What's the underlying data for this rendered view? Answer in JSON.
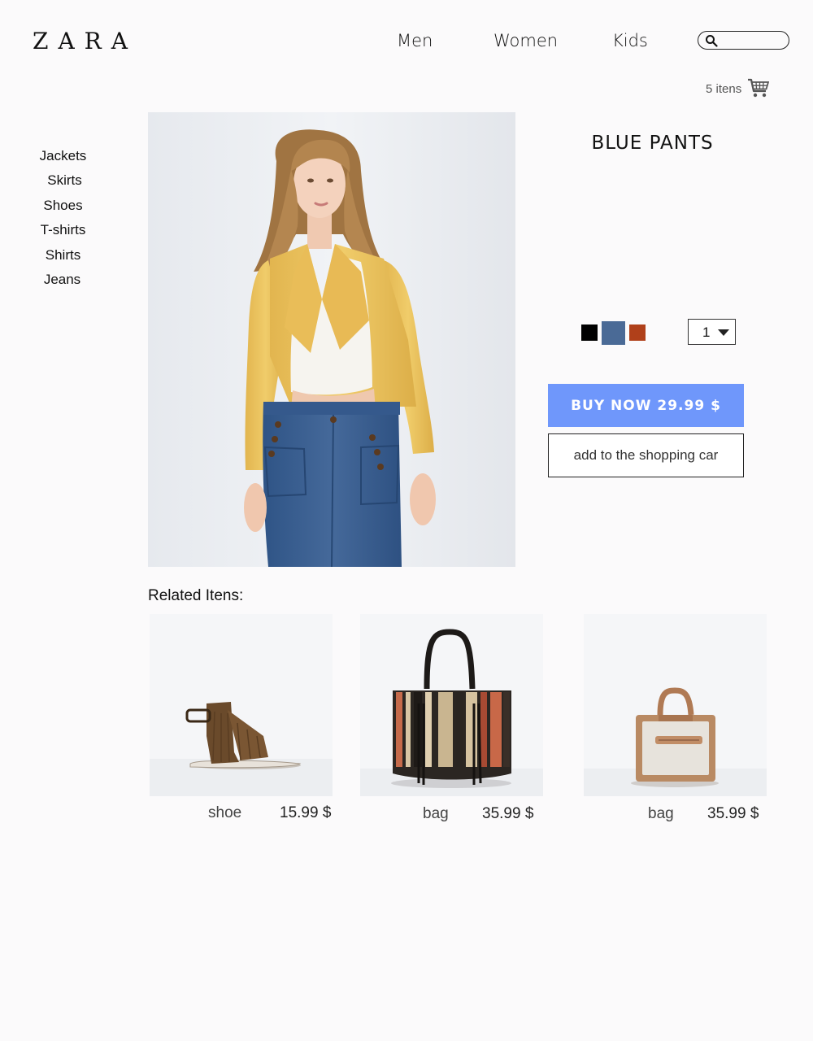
{
  "brand": {
    "logo": "ZARA"
  },
  "nav": {
    "items": [
      "Men",
      "Women",
      "Kids"
    ]
  },
  "search": {
    "placeholder": "",
    "value": ""
  },
  "cart": {
    "count_label": "5 itens"
  },
  "sidebar": {
    "categories": [
      "Jackets",
      "Skirts",
      "Shoes",
      "T-shirts",
      "Shirts",
      "Jeans"
    ]
  },
  "product": {
    "title": "BLUE PANTS",
    "colors": [
      "#000000",
      "#4a6a96",
      "#b0401a"
    ],
    "selected_color": "#4a6a96",
    "quantity": "1",
    "buy_label": "BUY NOW 29.99 $",
    "add_label": "add to the shopping car"
  },
  "related": {
    "title": "Related Itens:",
    "items": [
      {
        "name": "shoe",
        "price": "15.99 $",
        "icon": "sandal-image"
      },
      {
        "name": "bag",
        "price": "35.99 $",
        "icon": "tote-bag-image"
      },
      {
        "name": "bag",
        "price": "35.99 $",
        "icon": "handbag-image"
      }
    ]
  }
}
